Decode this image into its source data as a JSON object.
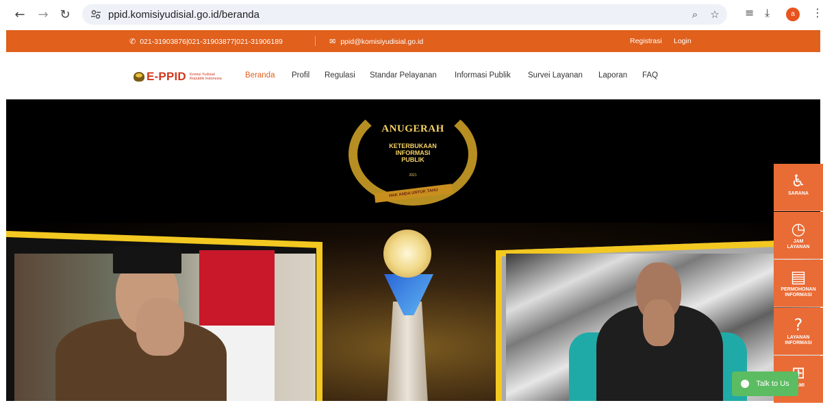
{
  "browser": {
    "url": "ppid.komisiyudisial.go.id/beranda",
    "profile_initial": "a"
  },
  "topbar": {
    "phones": "021-31903876|021-31903877|021-31906189",
    "email": "ppid@komisiyudisial.go.id",
    "register": "Registrasi",
    "login": "Login"
  },
  "logo": {
    "name": "E-PPID",
    "sub_line1": "Komisi Yudisial",
    "sub_line2": "Republik Indonesia"
  },
  "nav": {
    "beranda": "Beranda",
    "profil": "Profil",
    "regulasi": "Regulasi",
    "standar": "Standar Pelayanan",
    "informasi": "Informasi Publik",
    "survei": "Survei Layanan",
    "laporan": "Laporan",
    "faq": "FAQ"
  },
  "hero": {
    "award_title": "ANUGERAH",
    "award_line1": "KETERBUKAAN",
    "award_line2": "INFORMASI",
    "award_line3": "PUBLIK",
    "award_year": "2021",
    "award_ribbon": "HAK ANDA UNTUK TAHU"
  },
  "side": {
    "sarana": "SARANA",
    "jam_1": "JAM",
    "jam_2": "LAYANAN",
    "permohonan_1": "PERMOHONAN",
    "permohonan_2": "INFORMASI",
    "layanan_1": "LAYANAN",
    "layanan_2": "INFORMASI",
    "kami": "KAMI"
  },
  "chat": {
    "label": "Talk to Us"
  },
  "colors": {
    "brand_orange": "#e0601c",
    "side_orange": "#e96b35",
    "chat_green": "#5cbc61"
  }
}
